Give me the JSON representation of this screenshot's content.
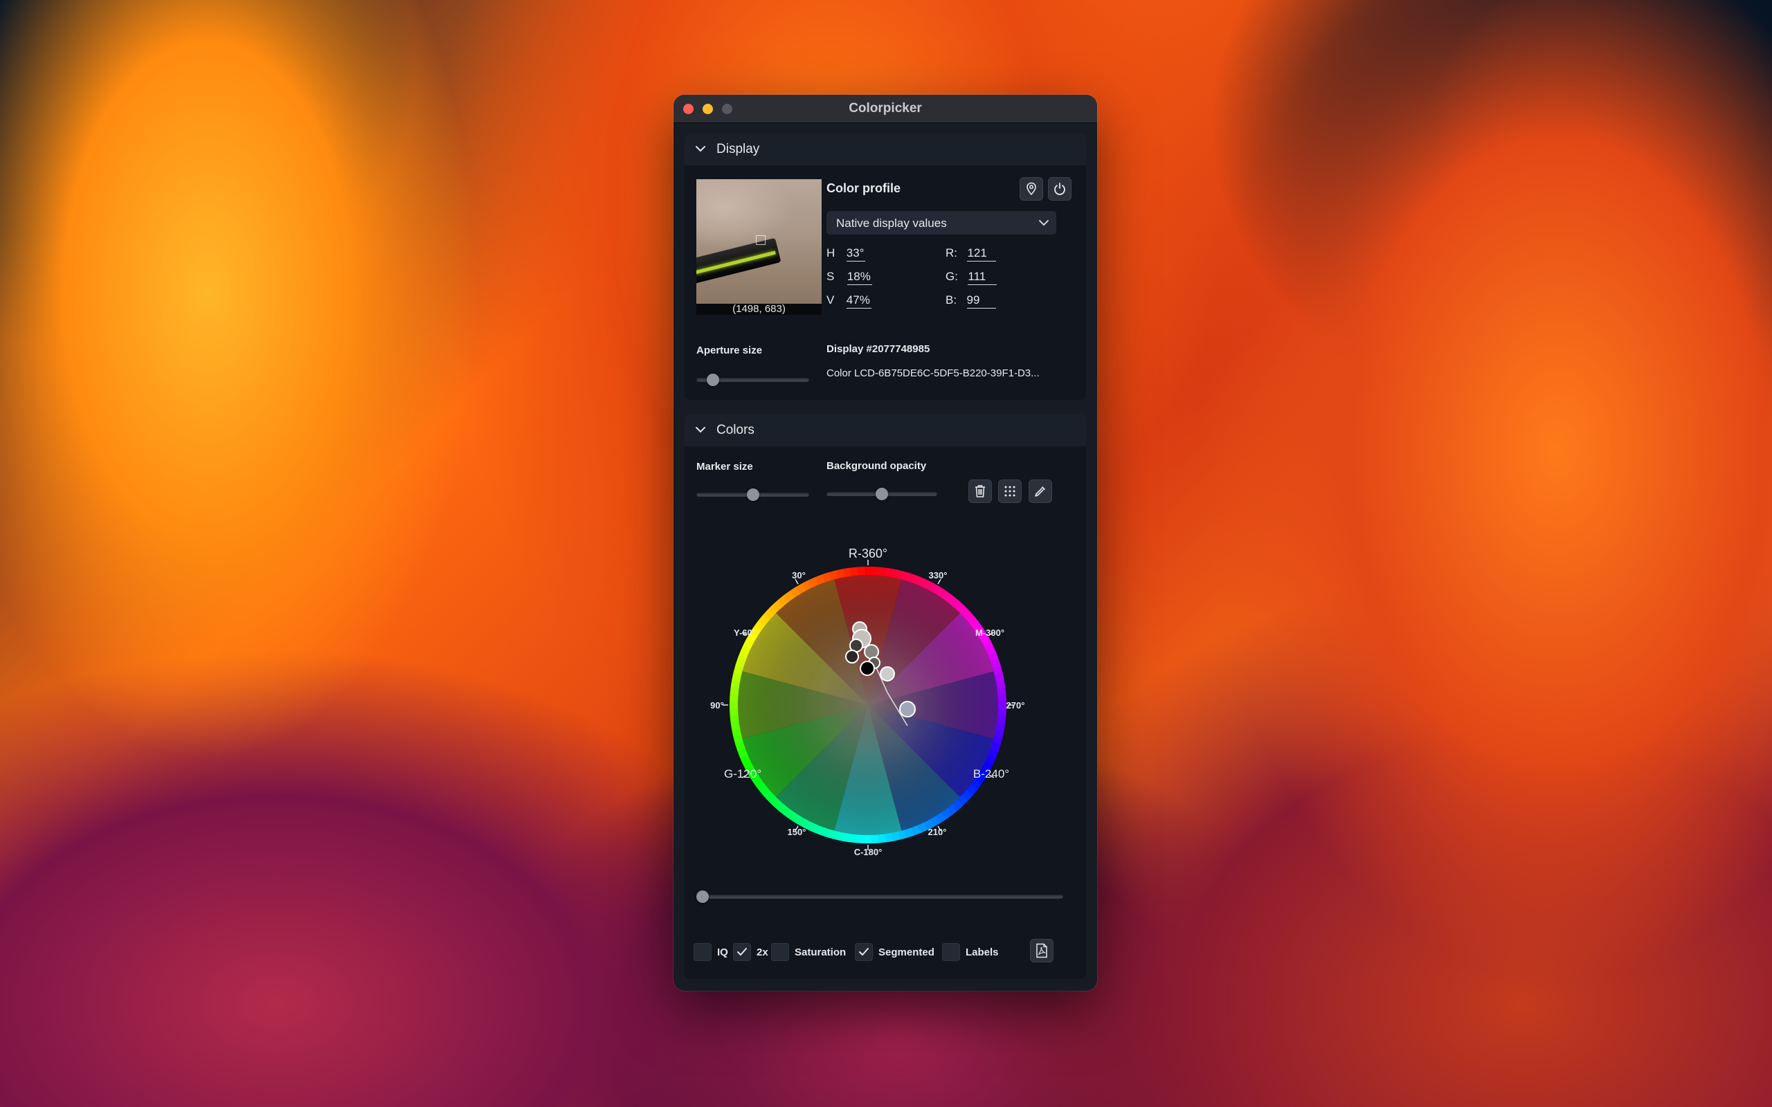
{
  "window": {
    "title": "Colorpicker"
  },
  "display": {
    "section_label": "Display",
    "coords": "(1498, 683)",
    "color_profile_label": "Color profile",
    "profile_value": "Native display values",
    "hsv": [
      {
        "key": "H",
        "value": "33°"
      },
      {
        "key": "S",
        "value": "18%"
      },
      {
        "key": "V",
        "value": "47%"
      }
    ],
    "rgb": [
      {
        "key": "R:",
        "value": "121"
      },
      {
        "key": "G:",
        "value": "111"
      },
      {
        "key": "B:",
        "value": "99"
      }
    ],
    "aperture_label": "Aperture size",
    "aperture_level": 0.1,
    "display_id": "Display #2077748985",
    "display_profile": "Color LCD-6B75DE6C-5DF5-B220-39F1-D3..."
  },
  "colors": {
    "section_label": "Colors",
    "marker_label": "Marker size",
    "marker_level": 0.5,
    "bg_opacity_label": "Background opacity",
    "bg_opacity_level": 0.5,
    "wheel_labels": {
      "top": "R-360°",
      "l330": "330°",
      "m300": "M-300°",
      "l270": "270°",
      "b240": "B-240°",
      "l210": "210°",
      "c180": "C-180°",
      "l150": "150°",
      "g120": "G-120°",
      "l90": "90°",
      "y60": "Y-60°",
      "l30": "30°"
    },
    "bottom_slider_level": 0.0,
    "options": [
      {
        "label": "IQ",
        "checked": false
      },
      {
        "label": "2x",
        "checked": true
      },
      {
        "label": "Saturation",
        "checked": false
      },
      {
        "label": "Segmented",
        "checked": true
      },
      {
        "label": "Labels",
        "checked": false
      }
    ]
  },
  "icons": {
    "pin": "location-pin-icon",
    "power": "power-icon",
    "trash": "trash-icon",
    "grid": "grid-icon",
    "eyedropper": "eyedropper-icon",
    "pdf": "pdf-export-icon"
  },
  "accent": "#e6e8ec"
}
